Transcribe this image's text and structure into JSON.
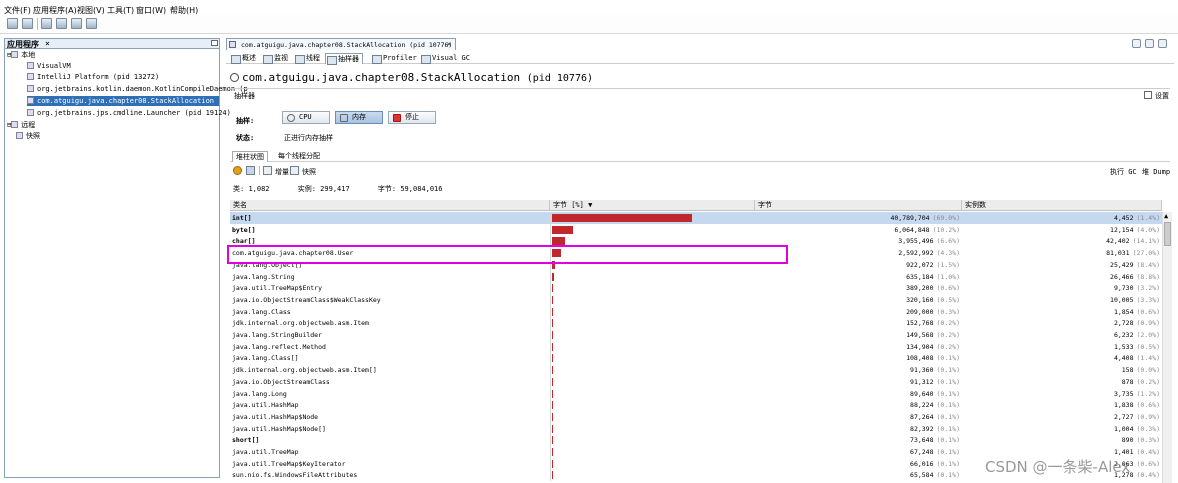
{
  "menu": [
    "文件(F)",
    "应用程序(A)",
    "视图(V)",
    "工具(T)",
    "窗口(W)",
    "帮助(H)"
  ],
  "left_panel": {
    "title": "应用程序",
    "tree": [
      {
        "label": "本地",
        "kind": "group"
      },
      {
        "label": "VisualVM",
        "kind": "app"
      },
      {
        "label": "IntelliJ Platform (pid 13272)",
        "kind": "app"
      },
      {
        "label": "org.jetbrains.kotlin.daemon.KotlinCompileDaemon (p",
        "kind": "app"
      },
      {
        "label": "com.atguigu.java.chapter08.StackAllocation (pid 10",
        "kind": "app",
        "selected": true
      },
      {
        "label": "org.jetbrains.jps.cmdline.Launcher (pid 19124)",
        "kind": "app"
      },
      {
        "label": "远程",
        "kind": "group"
      },
      {
        "label": "快照",
        "kind": "group"
      }
    ]
  },
  "doc_tab": {
    "label": "com.atguigu.java.chapter08.StackAllocation (pid 10776)",
    "close": "×"
  },
  "sub_tabs": [
    "概述",
    "监视",
    "线程",
    "抽样器",
    "Profiler",
    "Visual GC"
  ],
  "title": {
    "main": "com.atguigu.java.chapter08.StackAllocation",
    "pid": "(pid 10776)"
  },
  "sampler": {
    "section_label": "抽样器",
    "settings_label": "设置",
    "sample_label": "抽样:",
    "buttons": {
      "cpu": "CPU",
      "memory": "内存",
      "stop": "停止"
    },
    "status_label": "状态:",
    "status_value": "正进行内存抽样"
  },
  "view_tabs": [
    "堆柱状图",
    "每个线程分配"
  ],
  "actions": {
    "snapshot": "增量",
    "dump": "快照",
    "perform_gc": "执行 GC",
    "heap_dump": "堆 Dump"
  },
  "summary": {
    "classes_label": "类:",
    "classes": "1,082",
    "instances_label": "实例:",
    "instances": "299,417",
    "bytes_label": "字节:",
    "bytes": "59,084,016"
  },
  "table": {
    "headers": [
      "类名",
      "字节 [%] ▼",
      "字节",
      "实例数"
    ],
    "rows": [
      {
        "name": "int[]",
        "pct": 69.0,
        "bytes": "40,789,704",
        "bytes_pct": "(69.0%)",
        "inst": "4,452",
        "inst_pct": "(1.4%)",
        "selected": true
      },
      {
        "name": "byte[]",
        "pct": 10.2,
        "bytes": "6,064,848",
        "bytes_pct": "(10.2%)",
        "inst": "12,154",
        "inst_pct": "(4.0%)"
      },
      {
        "name": "char[]",
        "pct": 6.6,
        "bytes": "3,955,496",
        "bytes_pct": "(6.6%)",
        "inst": "42,402",
        "inst_pct": "(14.1%)"
      },
      {
        "name": "com.atguigu.java.chapter08.User",
        "pct": 4.3,
        "bytes": "2,592,992",
        "bytes_pct": "(4.3%)",
        "inst": "81,031",
        "inst_pct": "(27.0%)"
      },
      {
        "name": "java.lang.Object[]",
        "pct": 1.5,
        "bytes": "922,072",
        "bytes_pct": "(1.5%)",
        "inst": "25,429",
        "inst_pct": "(8.4%)"
      },
      {
        "name": "java.lang.String",
        "pct": 1.0,
        "bytes": "635,184",
        "bytes_pct": "(1.0%)",
        "inst": "26,466",
        "inst_pct": "(8.8%)"
      },
      {
        "name": "java.util.TreeMap$Entry",
        "pct": 0.6,
        "bytes": "389,200",
        "bytes_pct": "(0.6%)",
        "inst": "9,730",
        "inst_pct": "(3.2%)"
      },
      {
        "name": "java.io.ObjectStreamClass$WeakClassKey",
        "pct": 0.5,
        "bytes": "320,160",
        "bytes_pct": "(0.5%)",
        "inst": "10,005",
        "inst_pct": "(3.3%)"
      },
      {
        "name": "java.lang.Class",
        "pct": 0.3,
        "bytes": "209,000",
        "bytes_pct": "(0.3%)",
        "inst": "1,854",
        "inst_pct": "(0.6%)"
      },
      {
        "name": "jdk.internal.org.objectweb.asm.Item",
        "pct": 0.2,
        "bytes": "152,768",
        "bytes_pct": "(0.2%)",
        "inst": "2,728",
        "inst_pct": "(0.9%)"
      },
      {
        "name": "java.lang.StringBuilder",
        "pct": 0.2,
        "bytes": "149,568",
        "bytes_pct": "(0.2%)",
        "inst": "6,232",
        "inst_pct": "(2.0%)"
      },
      {
        "name": "java.lang.reflect.Method",
        "pct": 0.2,
        "bytes": "134,904",
        "bytes_pct": "(0.2%)",
        "inst": "1,533",
        "inst_pct": "(0.5%)"
      },
      {
        "name": "java.lang.Class[]",
        "pct": 0.1,
        "bytes": "108,408",
        "bytes_pct": "(0.1%)",
        "inst": "4,408",
        "inst_pct": "(1.4%)"
      },
      {
        "name": "jdk.internal.org.objectweb.asm.Item[]",
        "pct": 0.1,
        "bytes": "91,360",
        "bytes_pct": "(0.1%)",
        "inst": "158",
        "inst_pct": "(0.0%)"
      },
      {
        "name": "java.io.ObjectStreamClass",
        "pct": 0.1,
        "bytes": "91,312",
        "bytes_pct": "(0.1%)",
        "inst": "878",
        "inst_pct": "(0.2%)"
      },
      {
        "name": "java.lang.Long",
        "pct": 0.1,
        "bytes": "89,640",
        "bytes_pct": "(0.1%)",
        "inst": "3,735",
        "inst_pct": "(1.2%)"
      },
      {
        "name": "java.util.HashMap",
        "pct": 0.1,
        "bytes": "88,224",
        "bytes_pct": "(0.1%)",
        "inst": "1,838",
        "inst_pct": "(0.6%)"
      },
      {
        "name": "java.util.HashMap$Node",
        "pct": 0.1,
        "bytes": "87,264",
        "bytes_pct": "(0.1%)",
        "inst": "2,727",
        "inst_pct": "(0.9%)"
      },
      {
        "name": "java.util.HashMap$Node[]",
        "pct": 0.1,
        "bytes": "82,392",
        "bytes_pct": "(0.1%)",
        "inst": "1,004",
        "inst_pct": "(0.3%)"
      },
      {
        "name": "short[]",
        "pct": 0.1,
        "bytes": "73,648",
        "bytes_pct": "(0.1%)",
        "inst": "890",
        "inst_pct": "(0.3%)"
      },
      {
        "name": "java.util.TreeMap",
        "pct": 0.1,
        "bytes": "67,248",
        "bytes_pct": "(0.1%)",
        "inst": "1,401",
        "inst_pct": "(0.4%)"
      },
      {
        "name": "java.util.TreeMap$KeyIterator",
        "pct": 0.1,
        "bytes": "66,016",
        "bytes_pct": "(0.1%)",
        "inst": "2,063",
        "inst_pct": "(0.6%)"
      },
      {
        "name": "sun.nio.fs.WindowsFileAttributes",
        "pct": 0.1,
        "bytes": "65,584",
        "bytes_pct": "(0.1%)",
        "inst": "1,278",
        "inst_pct": "(0.4%)"
      }
    ]
  },
  "watermark": "CSDN @一条柴-Alex",
  "colors": {
    "bar": "#c0282b",
    "highlight": "#e000e0",
    "selection": "#2f6fb5"
  }
}
